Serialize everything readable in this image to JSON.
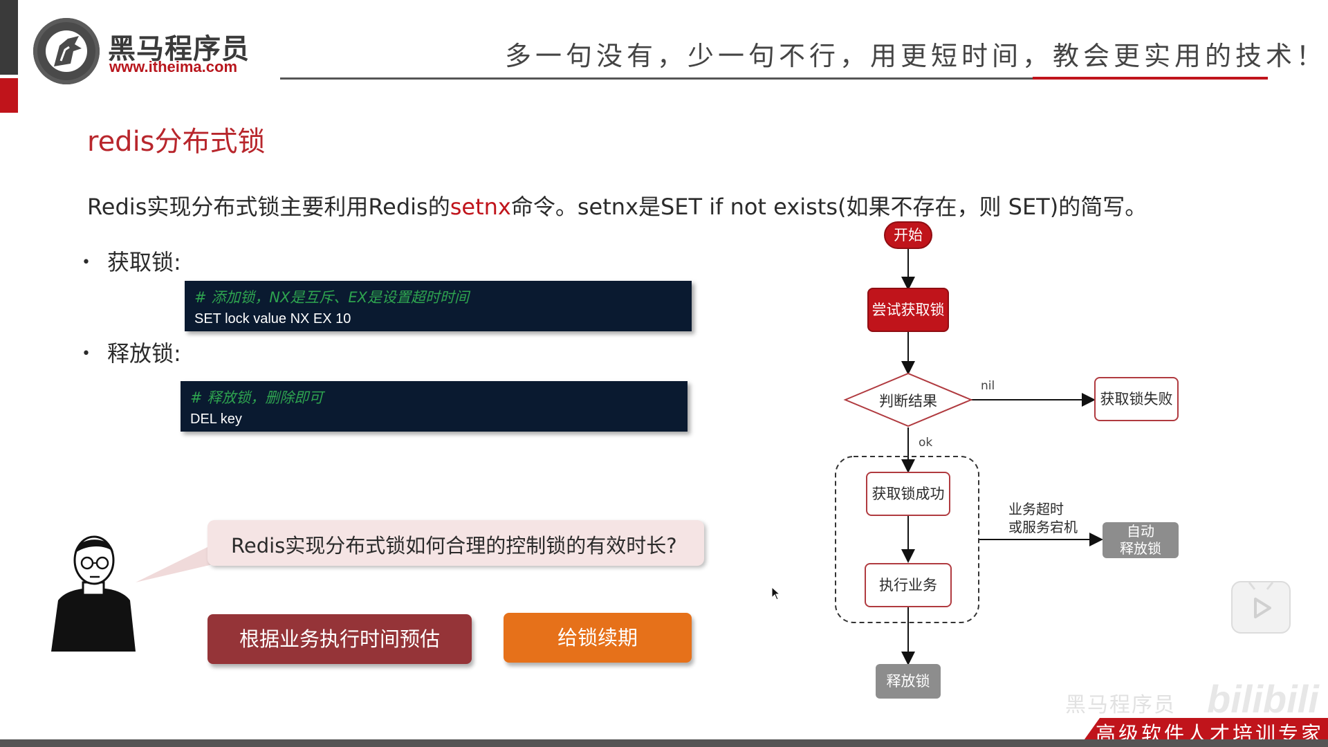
{
  "header": {
    "brand_name": "黑马程序员",
    "brand_url": "www.itheima.com",
    "slogan": "多一句没有，少一句不行，用更短时间，教会更实用的技术！"
  },
  "slide": {
    "title": "redis分布式锁",
    "intro_part1": "Redis实现分布式锁主要利用Redis的",
    "intro_highlight": "setnx",
    "intro_part2": "命令。setnx是SET if not exists(如果不存在，则 SET)的简写。",
    "acquire_label": "获取锁:",
    "acquire_code_comment": "# 添加锁，NX是互斥、EX是设置超时时间",
    "acquire_code_command": "SET lock value NX EX 10",
    "release_label": "释放锁:",
    "release_code_comment": "# 释放锁，删除即可",
    "release_code_command": "DEL key",
    "question": "Redis实现分布式锁如何合理的控制锁的有效时长?",
    "option_estimate": "根据业务执行时间预估",
    "option_renew": "给锁续期"
  },
  "flowchart": {
    "start": "开始",
    "try_acquire": "尝试获取锁",
    "judge": "判断结果",
    "nil_label": "nil",
    "fail": "获取锁失败",
    "ok_label": "ok",
    "success": "获取锁成功",
    "execute": "执行业务",
    "timeout_line1": "业务超时",
    "timeout_line2": "或服务宕机",
    "auto_release_line1": "自动",
    "auto_release_line2": "释放锁",
    "release": "释放锁"
  },
  "footer": {
    "tagline": "高级软件人才培训专家",
    "watermark_text": "黑马程序员",
    "watermark_logo": "bilibili"
  },
  "colors": {
    "brand_red": "#c0141b",
    "code_bg": "#0a1a30",
    "comment_green": "#2ea44f",
    "button_dark_red": "#953438",
    "button_orange": "#e6711a",
    "bubble_pink": "#f5e4e4",
    "node_gray": "#8d8d8d"
  }
}
